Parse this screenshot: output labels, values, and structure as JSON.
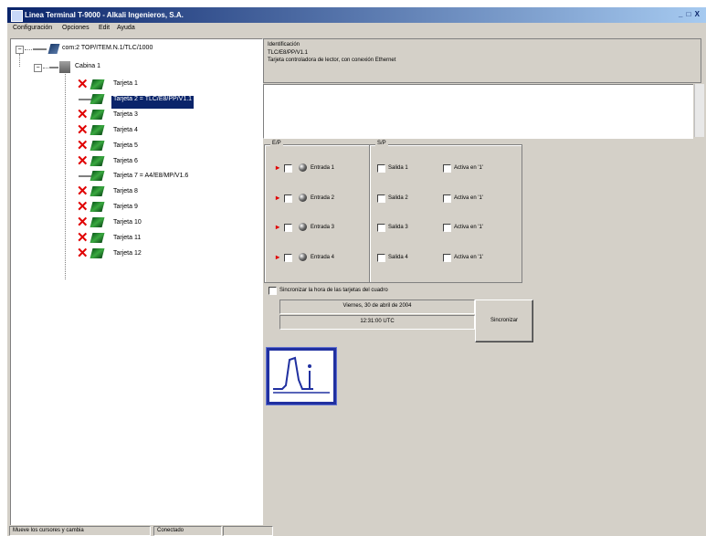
{
  "window": {
    "title": "Linea Terminal T-9000 - Alkali Ingenieros, S.A.",
    "controls": "_ □ X"
  },
  "menu": [
    "Configuración",
    "Opciones",
    "Edit",
    "Ayuda"
  ],
  "tree": {
    "root": "com:2 TOP/ITEM.N.1/TLC/1000",
    "cabin": "Cabina 1",
    "cards": [
      {
        "label": "Tarjeta 1",
        "status": "error"
      },
      {
        "label": "Tarjeta 2 = TLC/E8/PP/V1.1",
        "status": "connected",
        "selected": true
      },
      {
        "label": "Tarjeta 3",
        "status": "error"
      },
      {
        "label": "Tarjeta 4",
        "status": "error"
      },
      {
        "label": "Tarjeta 5",
        "status": "error"
      },
      {
        "label": "Tarjeta 6",
        "status": "error"
      },
      {
        "label": "Tarjeta 7 = A4/E8/MP/V1.6",
        "status": "connected"
      },
      {
        "label": "Tarjeta 8",
        "status": "error"
      },
      {
        "label": "Tarjeta 9",
        "status": "error"
      },
      {
        "label": "Tarjeta 10",
        "status": "error"
      },
      {
        "label": "Tarjeta 11",
        "status": "error"
      },
      {
        "label": "Tarjeta 12",
        "status": "error"
      }
    ]
  },
  "identification": {
    "heading": "Identificación",
    "code": "TLC/E8/PP/V1.1",
    "description": "Tarjeta controladora de lector, con conexión Ethernet"
  },
  "inputs": {
    "title": "E/P",
    "items": [
      "Entrada 1",
      "Entrada 2",
      "Entrada 3",
      "Entrada 4"
    ]
  },
  "outputs": {
    "title": "S/P",
    "items": [
      "Salida 1",
      "Salida 2",
      "Salida 3",
      "Salida 4"
    ],
    "options": [
      "Activa en '1'",
      "Activa en '1'",
      "Activa en '1'",
      "Activa en '1'"
    ]
  },
  "sync": {
    "checkbox_label": "Sincronizar la hora de las tarjetas del cuadro",
    "date": "Viernes, 30 de abril de 2004",
    "time": "12:31:00 UTC",
    "button": "Sincronizar"
  },
  "status": {
    "left": "Mueve los cursores y cambia",
    "right": "Conectado"
  },
  "colors": {
    "selection": "#0a246a",
    "error": "#e00000",
    "card": "#3aa840",
    "logo_border": "#2030a0"
  }
}
